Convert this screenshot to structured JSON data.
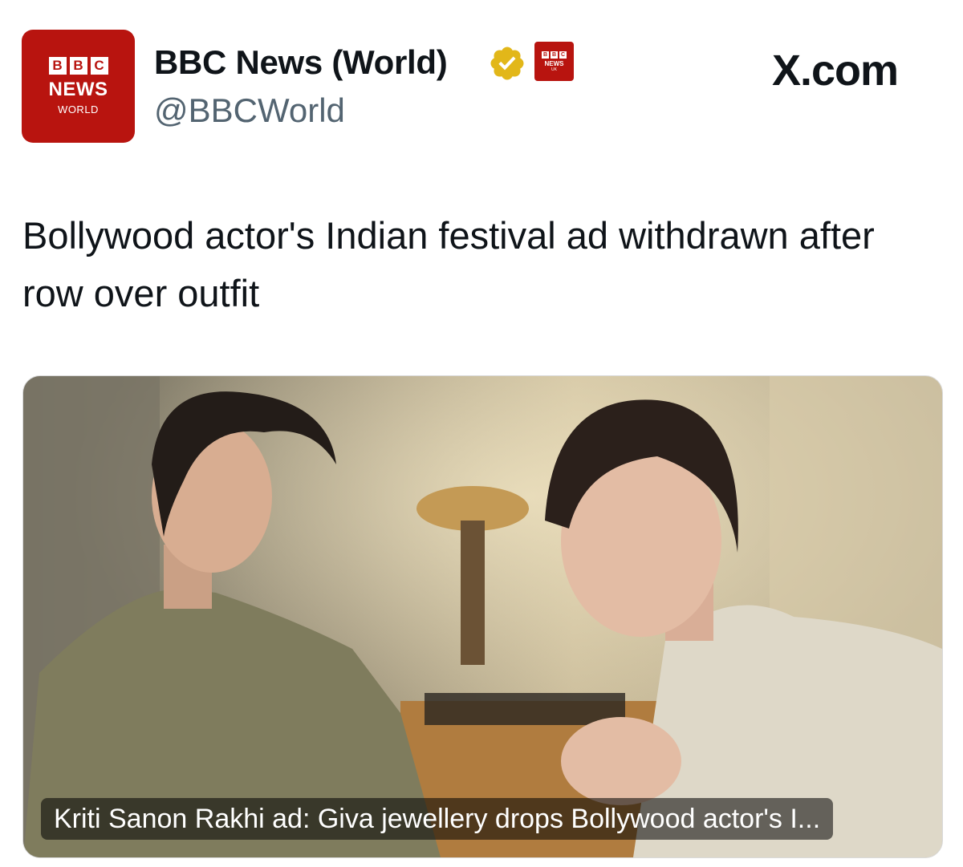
{
  "account": {
    "avatar": {
      "blocks": [
        "B",
        "B",
        "C"
      ],
      "line1": "NEWS",
      "line2": "WORLD"
    },
    "display_name": "BBC News (World)",
    "handle": "@BBCWorld",
    "affiliate_badge": {
      "blocks": [
        "B",
        "B",
        "C"
      ],
      "line1": "NEWS",
      "line2": "UK"
    }
  },
  "source": "X.com",
  "post": {
    "headline": "Bollywood actor's Indian festival ad withdrawn after row over outfit"
  },
  "link_card": {
    "caption": "Kriti Sanon Rakhi ad: Giva jewellery drops Bollywood actor's I..."
  },
  "colors": {
    "bbc_red": "#b8140f",
    "verified_gold": "#e2b719",
    "handle_gray": "#536471"
  }
}
